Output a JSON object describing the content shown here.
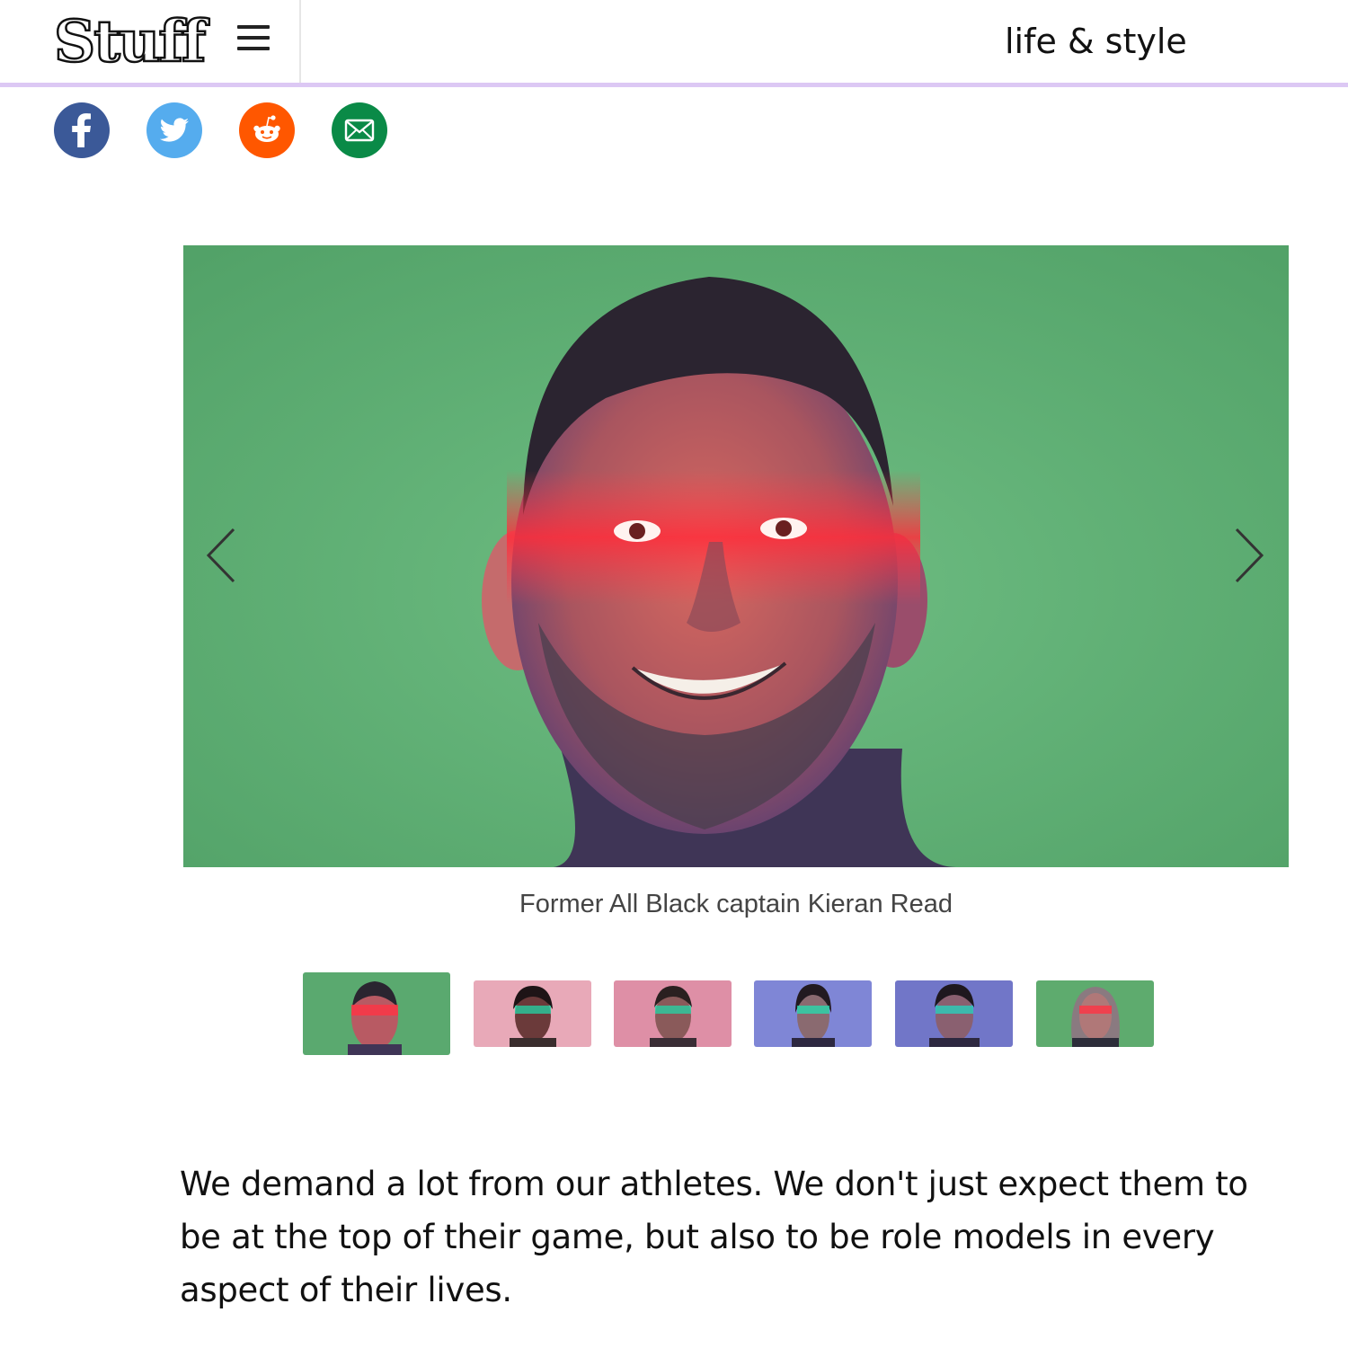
{
  "header": {
    "logo_text": "Stuff",
    "section_title": "life & style"
  },
  "share": [
    {
      "name": "facebook",
      "color": "#3b5998"
    },
    {
      "name": "twitter",
      "color": "#55acee"
    },
    {
      "name": "reddit",
      "color": "#ff5700"
    },
    {
      "name": "email",
      "color": "#0a8a47"
    }
  ],
  "gallery": {
    "caption": "Former All Black captain Kieran Read",
    "thumbnails": [
      {
        "bg": "#5aa96f",
        "selected": true
      },
      {
        "bg": "#e8a9b8",
        "selected": false
      },
      {
        "bg": "#de8fa6",
        "selected": false
      },
      {
        "bg": "#7f86d6",
        "selected": false
      },
      {
        "bg": "#7176c8",
        "selected": false
      },
      {
        "bg": "#5eab6e",
        "selected": false
      }
    ]
  },
  "article": {
    "intro": "We demand a lot from our athletes. We don't just expect them to be at the top of their game, but also to be role models in every aspect of their lives."
  }
}
